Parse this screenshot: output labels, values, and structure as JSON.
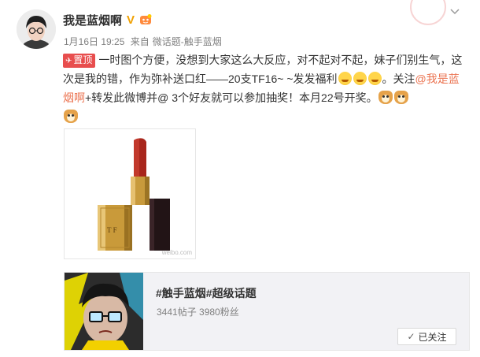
{
  "post": {
    "username": "我是蓝烟啊",
    "verified_icon": "V",
    "fan_icon": "fan-badge-icon",
    "date": "1月16日 19:25",
    "via_prefix": "来自",
    "source": "微话题-触手蓝烟",
    "pin_label": "置顶",
    "text_1": "一时图个方便，没想到大家这么大反应，对不起对不起，妹子们别生气，这次是我的错，作为弥补送口红——20支TF16~ ~发发福利",
    "text_2": "。关注",
    "mention": "@我是蓝烟啊",
    "text_3": "+转发此微博并@ 3个好友就可以参加抽奖！本月22号开奖。",
    "image_watermark": "weibo.com"
  },
  "card": {
    "title": "#触手蓝烟#超级话题",
    "stats": "3441帖子 3980粉丝",
    "follow_label": "已关注"
  }
}
